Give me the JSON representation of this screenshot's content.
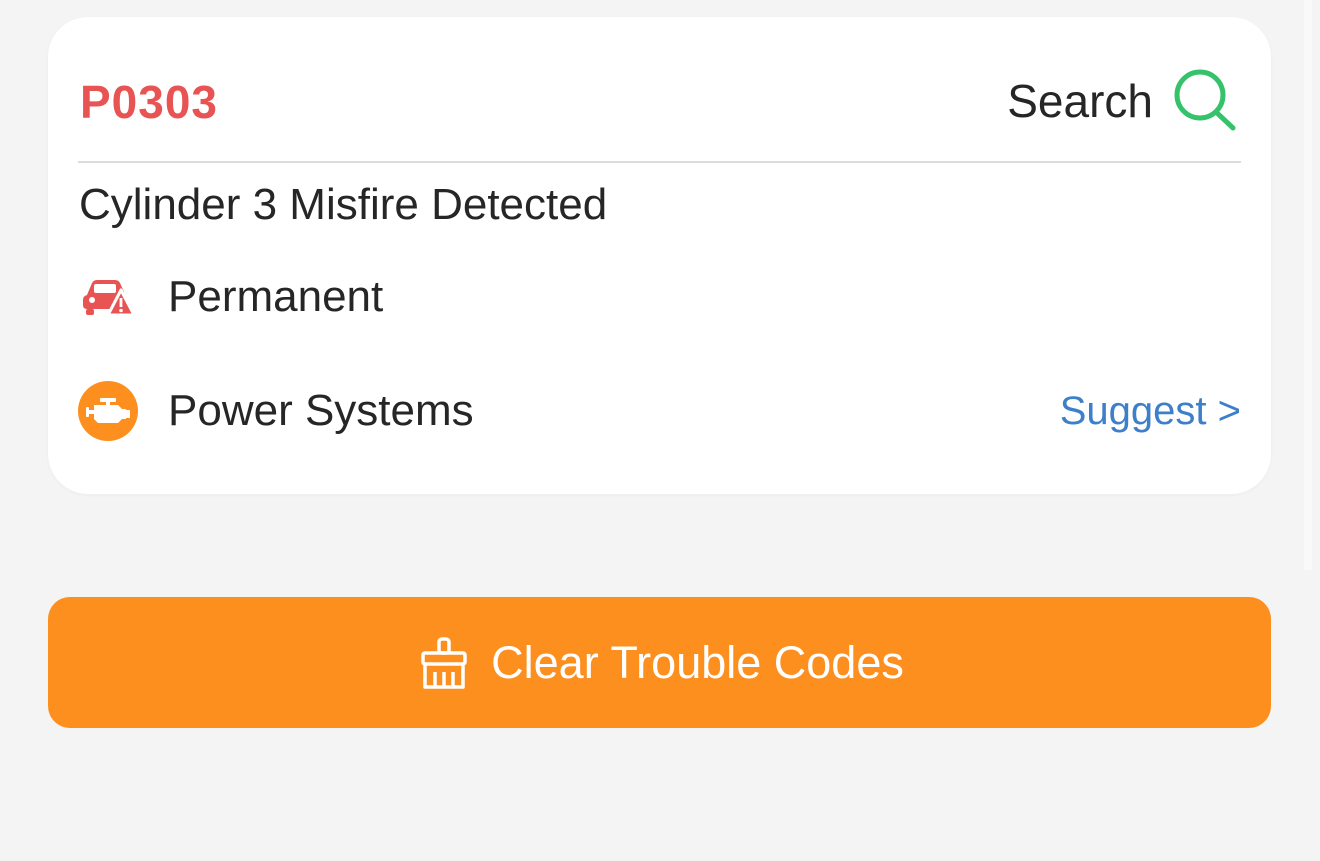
{
  "dtc": {
    "code": "P0303",
    "code_color": "#e85453",
    "description": "Cylinder 3 Misfire Detected"
  },
  "search": {
    "label": "Search",
    "icon": "search-icon",
    "icon_color": "#35c26b"
  },
  "status": {
    "icon": "car-warning-icon",
    "label": "Permanent",
    "icon_color": "#e85453"
  },
  "system": {
    "icon": "engine-icon",
    "label": "Power Systems",
    "icon_color": "#fd8f1f",
    "suggest_label": "Suggest >",
    "suggest_color": "#3d7fc9"
  },
  "actions": {
    "clear_label": "Clear Trouble Codes",
    "clear_icon": "broom-icon",
    "clear_color": "#fd8f1f"
  }
}
